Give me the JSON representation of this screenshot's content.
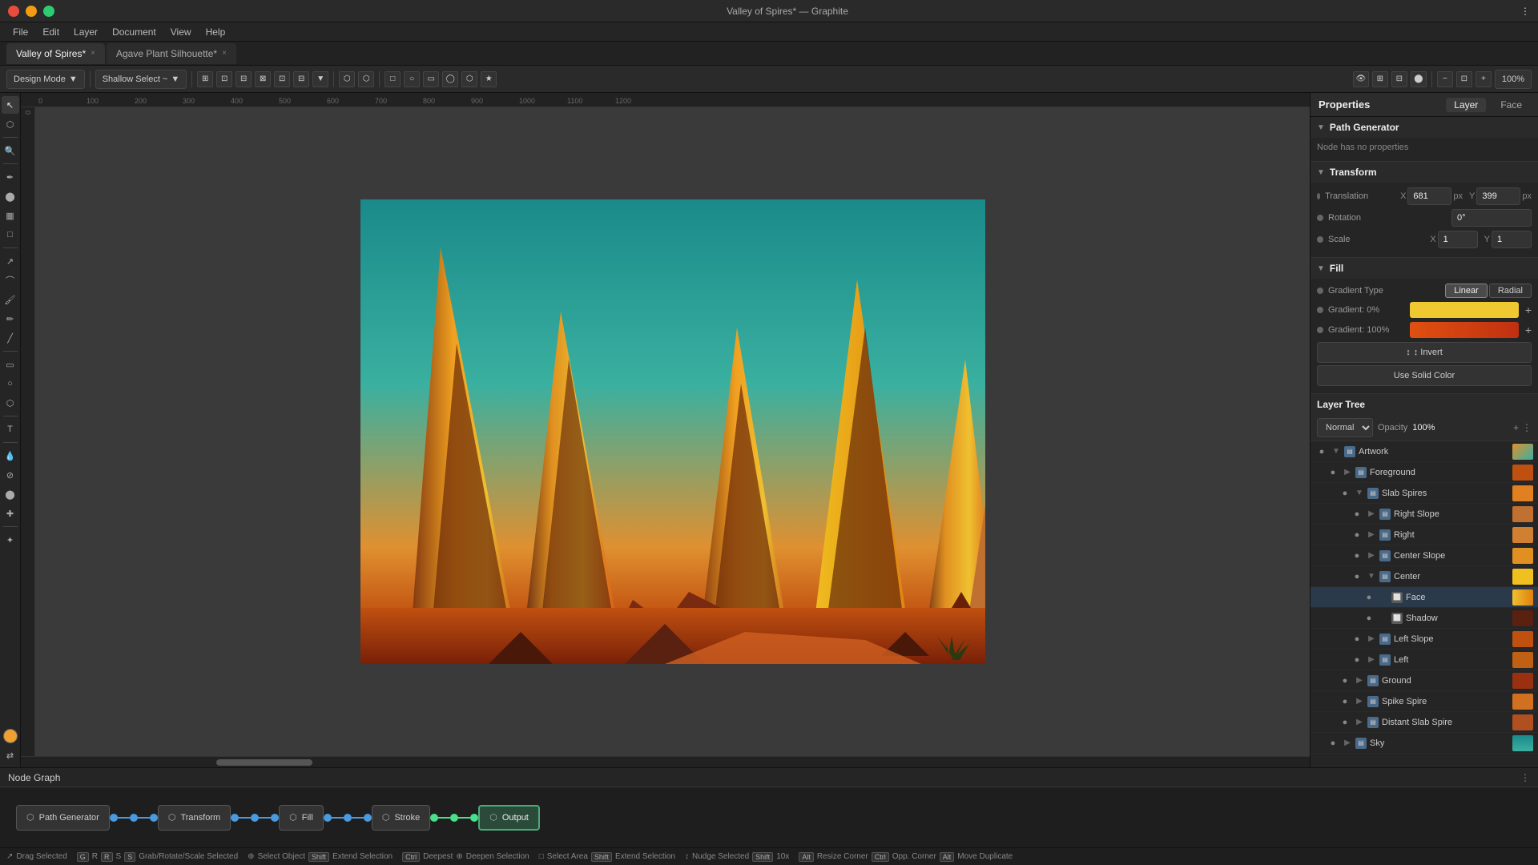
{
  "titleBar": {
    "title": "Valley of Spires* — Graphite",
    "windowButtons": [
      "close",
      "minimize",
      "maximize"
    ]
  },
  "menuBar": {
    "items": [
      "File",
      "Edit",
      "Layer",
      "Document",
      "View",
      "Help"
    ]
  },
  "tabs": [
    {
      "id": "valley",
      "label": "Valley of Spires*",
      "active": true
    },
    {
      "id": "agave",
      "label": "Agave Plant Silhouette*",
      "active": false
    }
  ],
  "toolbar": {
    "modeSelect": "Design Mode",
    "selectMode": "Shallow Select ~",
    "zoomLevel": "100%"
  },
  "properties": {
    "title": "Properties",
    "panelTabs": [
      "Layer",
      "Face"
    ],
    "pathGenerator": {
      "sectionTitle": "Path Generator",
      "nodeHasNoProperties": "Node has no properties"
    },
    "transform": {
      "sectionTitle": "Transform",
      "translation": {
        "label": "Translation",
        "x": "681",
        "xUnit": "px",
        "y": "399",
        "yUnit": "px"
      },
      "rotation": {
        "label": "Rotation",
        "value": "0°"
      },
      "scale": {
        "label": "Scale",
        "x": "1",
        "y": "1"
      }
    },
    "fill": {
      "sectionTitle": "Fill",
      "gradientType": {
        "label": "Gradient Type",
        "options": [
          "Linear",
          "Radial"
        ],
        "active": "Linear"
      },
      "gradient0": {
        "label": "Gradient: 0%",
        "color": "#f0c830"
      },
      "gradient100": {
        "label": "Gradient: 100%",
        "color": "#c03010"
      },
      "invertLabel": "↕ Invert",
      "useSolidColor": "Use Solid Color"
    }
  },
  "layerTree": {
    "title": "Layer Tree",
    "blendMode": "Normal",
    "opacity": "Opacity",
    "opacityValue": "100%",
    "layers": [
      {
        "id": "artwork",
        "name": "Artwork",
        "type": "folder",
        "indent": 0,
        "expanded": true
      },
      {
        "id": "foreground",
        "name": "Foreground",
        "type": "folder",
        "indent": 1,
        "expanded": true
      },
      {
        "id": "slabSpires",
        "name": "Slab Spires",
        "type": "folder",
        "indent": 2,
        "expanded": true
      },
      {
        "id": "rightSlope",
        "name": "Right Slope",
        "type": "folder",
        "indent": 3,
        "expanded": false
      },
      {
        "id": "right",
        "name": "Right",
        "type": "folder",
        "indent": 3,
        "expanded": false
      },
      {
        "id": "centerSlope",
        "name": "Center Slope",
        "type": "folder",
        "indent": 3,
        "expanded": false
      },
      {
        "id": "center",
        "name": "Center",
        "type": "folder",
        "indent": 3,
        "expanded": true
      },
      {
        "id": "face",
        "name": "Face",
        "type": "shape",
        "indent": 4,
        "selected": true
      },
      {
        "id": "shadow",
        "name": "Shadow",
        "type": "shape",
        "indent": 4
      },
      {
        "id": "leftSlope",
        "name": "Left Slope",
        "type": "folder",
        "indent": 3,
        "expanded": false
      },
      {
        "id": "left",
        "name": "Left",
        "type": "folder",
        "indent": 3,
        "expanded": false
      },
      {
        "id": "ground",
        "name": "Ground",
        "type": "folder",
        "indent": 2,
        "expanded": false
      },
      {
        "id": "spikeSpire",
        "name": "Spike Spire",
        "type": "folder",
        "indent": 2,
        "expanded": false
      },
      {
        "id": "distantSlabSpire",
        "name": "Distant Slab Spire",
        "type": "folder",
        "indent": 2,
        "expanded": false
      },
      {
        "id": "sky",
        "name": "Sky",
        "type": "folder",
        "indent": 1,
        "expanded": false
      }
    ]
  },
  "nodeGraph": {
    "title": "Node Graph",
    "nodes": [
      {
        "id": "pathGenerator",
        "label": "Path Generator",
        "icon": "⬡"
      },
      {
        "id": "transform",
        "label": "Transform",
        "icon": "⬡"
      },
      {
        "id": "fill",
        "label": "Fill",
        "icon": "⬡"
      },
      {
        "id": "stroke",
        "label": "Stroke",
        "icon": "⬡"
      },
      {
        "id": "output",
        "label": "Output",
        "icon": "⬡",
        "active": true
      }
    ]
  },
  "statusBar": {
    "items": [
      {
        "icon": "↗",
        "label": "Drag Selected"
      },
      {
        "key": "G",
        "label": "Grab/Rotate/Scale Selected"
      },
      {
        "key": "R",
        "label": ""
      },
      {
        "key": "S",
        "label": ""
      },
      {
        "icon": "⊕",
        "label": "Select Object"
      },
      {
        "key": "Shift",
        "label": "Extend Selection"
      },
      {
        "key": "Ctrl",
        "label": "Deepest"
      },
      {
        "icon": "⊕",
        "label": "Deepen Selection"
      },
      {
        "icon": "□",
        "label": "Select Area"
      },
      {
        "key": "Shift",
        "label": "Extend Selection"
      },
      {
        "icon": "↑↓",
        "label": "Nudge Selected"
      },
      {
        "key": "Shift",
        "label": "10x"
      },
      {
        "key": "Alt",
        "label": "Resize Corner"
      },
      {
        "key": "Ctrl",
        "label": "Opp. Corner"
      },
      {
        "key": "Alt",
        "label": "Move Duplicate"
      }
    ]
  },
  "icons": {
    "chevronRight": "▶",
    "chevronDown": "▼",
    "eye": "●",
    "folder": "▤",
    "shape": "⬜",
    "invert": "↕",
    "plus": "+",
    "moreOptions": "⋮"
  }
}
